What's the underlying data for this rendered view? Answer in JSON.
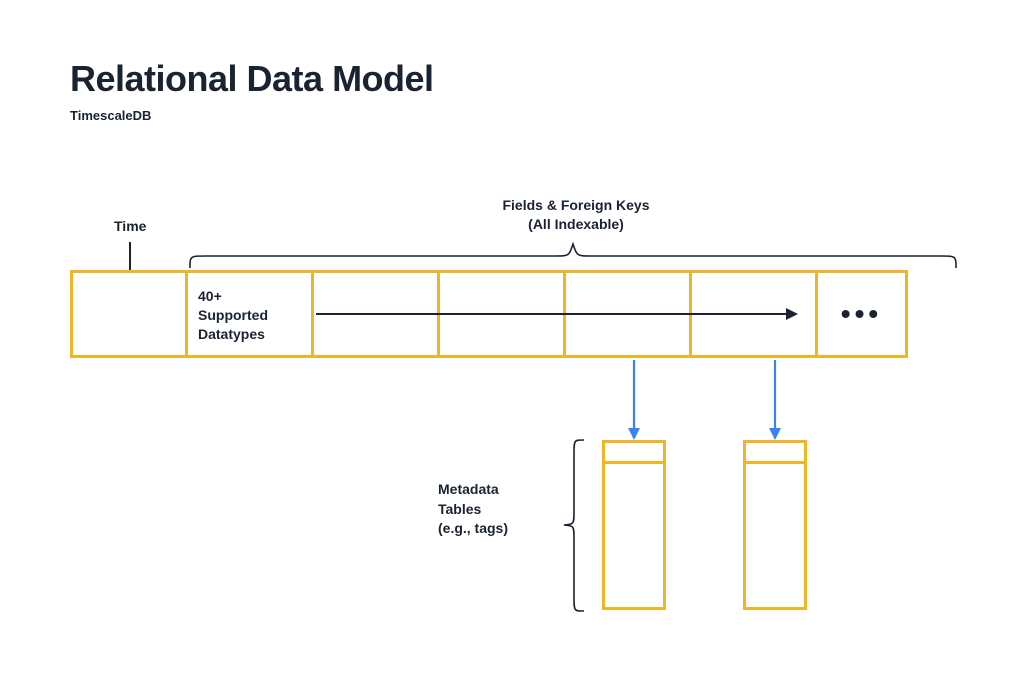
{
  "title": "Relational Data Model",
  "subtitle": "TimescaleDB",
  "labels": {
    "time": "Time",
    "fields_line1": "Fields & Foreign Keys",
    "fields_line2": "(All Indexable)",
    "datatypes": "40+\nSupported\nDatatypes",
    "metadata_line1": "Metadata",
    "metadata_line2": "Tables",
    "metadata_line3": "(e.g., tags)",
    "ellipsis": "•••"
  },
  "colors": {
    "cell_border": "#f0b429",
    "text": "#1a2332",
    "blue_arrow": "#3b82f6"
  }
}
